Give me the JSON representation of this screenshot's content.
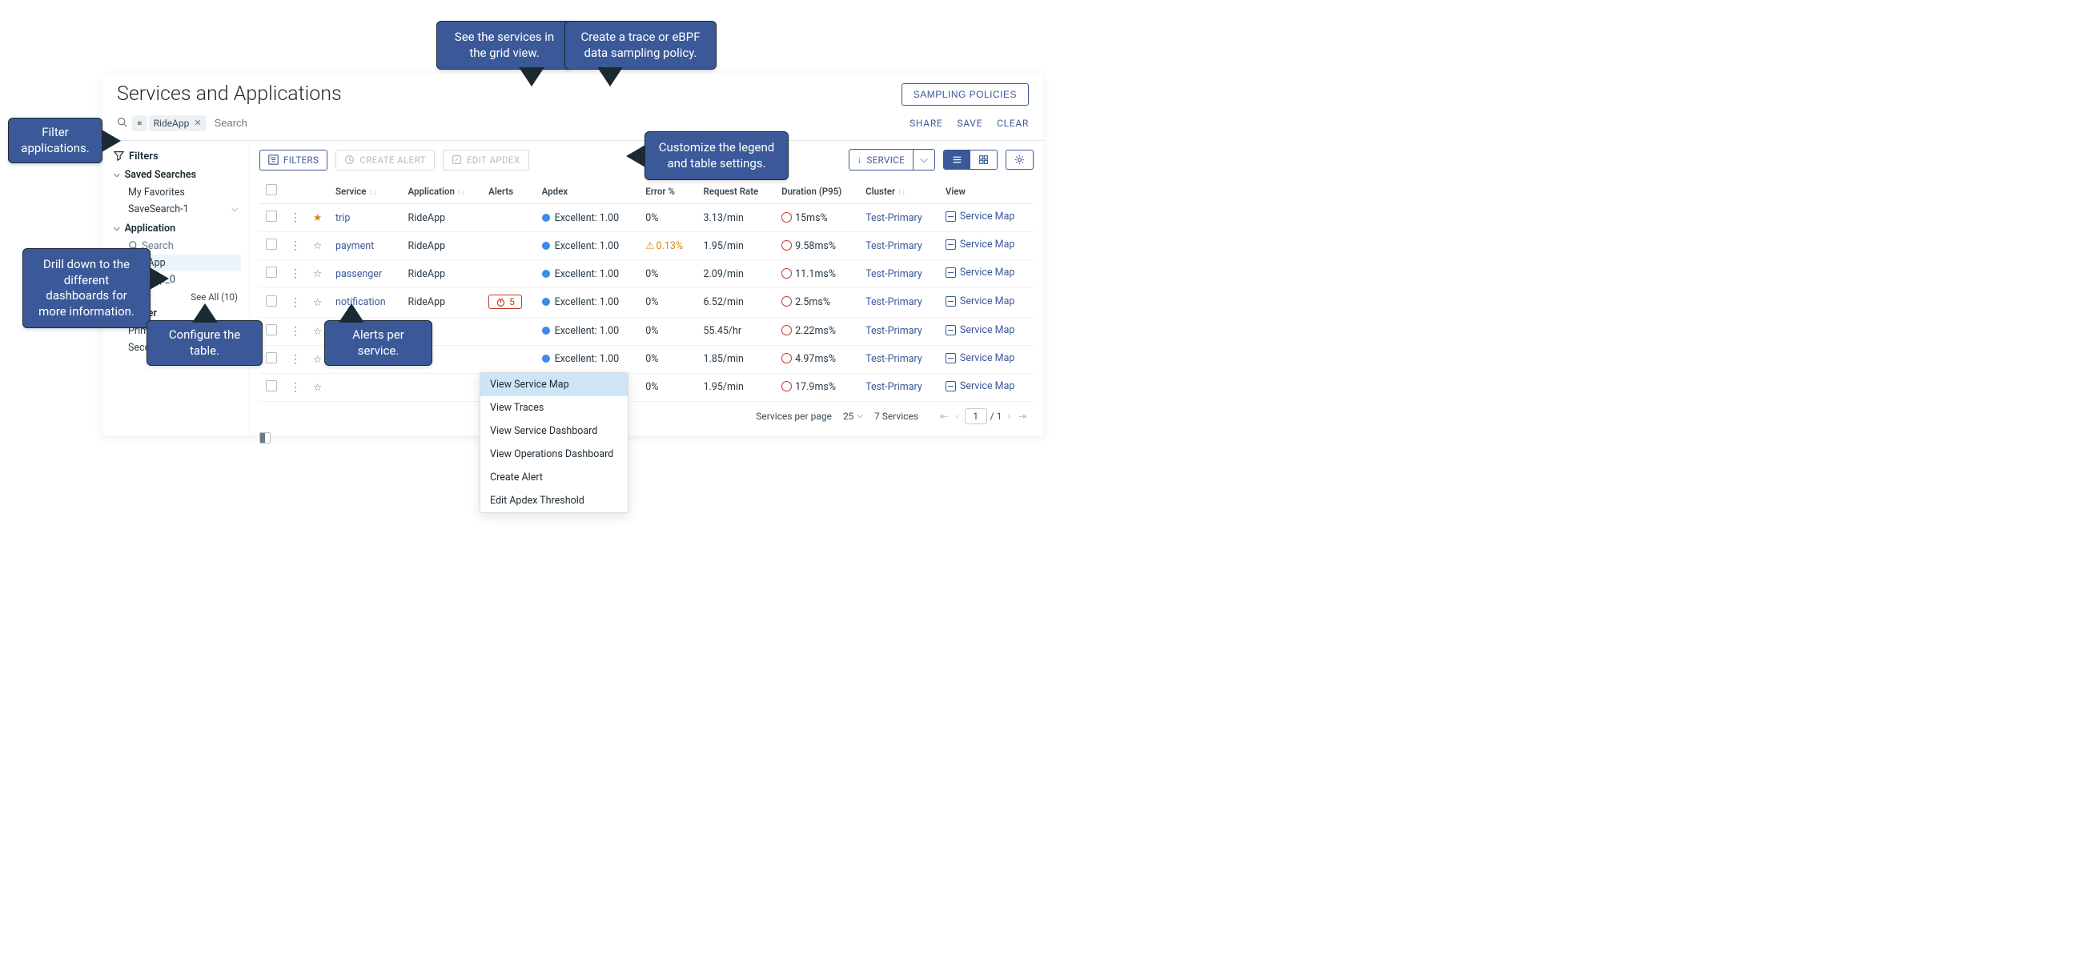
{
  "page": {
    "title": "Services and Applications",
    "sampling_policies_btn": "SAMPLING POLICIES"
  },
  "search": {
    "eq": "=",
    "chip_value": "RideApp",
    "placeholder": "Search",
    "actions": {
      "share": "SHARE",
      "save": "SAVE",
      "clear": "CLEAR"
    }
  },
  "sidebar": {
    "filters_label": "Filters",
    "sections": {
      "saved": {
        "label": "Saved Searches",
        "items": [
          {
            "label": "My Favorites"
          },
          {
            "label": "SaveSearch-1"
          }
        ]
      },
      "application": {
        "label": "Application",
        "search_placeholder": "Search",
        "items": [
          {
            "label": "RideApp",
            "selected": true
          },
          {
            "label": "TestApp_0"
          }
        ],
        "see_all": "See All (10)"
      },
      "cluster": {
        "label": "Cluster",
        "items": [
          {
            "label": "Primary"
          },
          {
            "label": "Secondary"
          }
        ]
      }
    }
  },
  "toolbar": {
    "filters": "FILTERS",
    "create_alert": "CREATE ALERT",
    "edit_apdex": "EDIT APDEX",
    "service_dropdown": "SERVICE"
  },
  "columns": {
    "service": "Service",
    "application": "Application",
    "alerts": "Alerts",
    "apdex": "Apdex",
    "error": "Error %",
    "request_rate": "Request Rate",
    "duration": "Duration (P95)",
    "cluster": "Cluster",
    "view": "View"
  },
  "rows": [
    {
      "fav": true,
      "service": "trip",
      "app": "RideApp",
      "alerts": "",
      "apdex": "Excellent: 1.00",
      "error": "0%",
      "rate": "3.13/min",
      "dur": "15ms%",
      "cluster": "Test-Primary",
      "view": "Service Map"
    },
    {
      "fav": false,
      "service": "payment",
      "app": "RideApp",
      "alerts": "",
      "apdex": "Excellent: 1.00",
      "error": "0.13%",
      "error_warn": true,
      "rate": "1.95/min",
      "dur": "9.58ms%",
      "cluster": "Test-Primary",
      "view": "Service Map"
    },
    {
      "fav": false,
      "service": "passenger",
      "app": "RideApp",
      "alerts": "",
      "apdex": "Excellent: 1.00",
      "error": "0%",
      "rate": "2.09/min",
      "dur": "11.1ms%",
      "cluster": "Test-Primary",
      "view": "Service Map"
    },
    {
      "fav": false,
      "service": "notification",
      "app": "RideApp",
      "alerts": "5",
      "apdex": "Excellent: 1.00",
      "error": "0%",
      "rate": "6.52/min",
      "dur": "2.5ms%",
      "cluster": "Test-Primary",
      "view": "Service Map"
    },
    {
      "fav": false,
      "service": "",
      "app": "",
      "alerts": "",
      "apdex": "Excellent: 1.00",
      "error": "0%",
      "rate": "55.45/hr",
      "dur": "2.22ms%",
      "cluster": "Test-Primary",
      "view": "Service Map"
    },
    {
      "fav": false,
      "service": "",
      "app": "",
      "alerts": "",
      "apdex": "Excellent: 1.00",
      "error": "0%",
      "rate": "1.85/min",
      "dur": "4.97ms%",
      "cluster": "Test-Primary",
      "view": "Service Map"
    },
    {
      "fav": false,
      "service": "",
      "app": "",
      "alerts": "",
      "apdex": "Excellent: 1.00",
      "error": "0%",
      "rate": "1.95/min",
      "dur": "17.9ms%",
      "cluster": "Test-Primary",
      "view": "Service Map"
    }
  ],
  "context_menu": {
    "items": [
      "View Service Map",
      "View Traces",
      "View Service Dashboard",
      "View Operations Dashboard",
      "Create Alert",
      "Edit Apdex Threshold"
    ]
  },
  "pager": {
    "per_page_label": "Services per page",
    "per_page_value": "25",
    "total_label": "7 Services",
    "page_current": "1",
    "page_total": "/ 1"
  },
  "callouts": {
    "grid_view": "See the services in the grid view.",
    "sampling": "Create a trace or eBPF data sampling policy.",
    "filter": "Filter applications.",
    "settings": "Customize the legend and table settings.",
    "drill": "Drill down to the different dashboards for more information.",
    "configure": "Configure the table.",
    "alerts": "Alerts per service."
  }
}
